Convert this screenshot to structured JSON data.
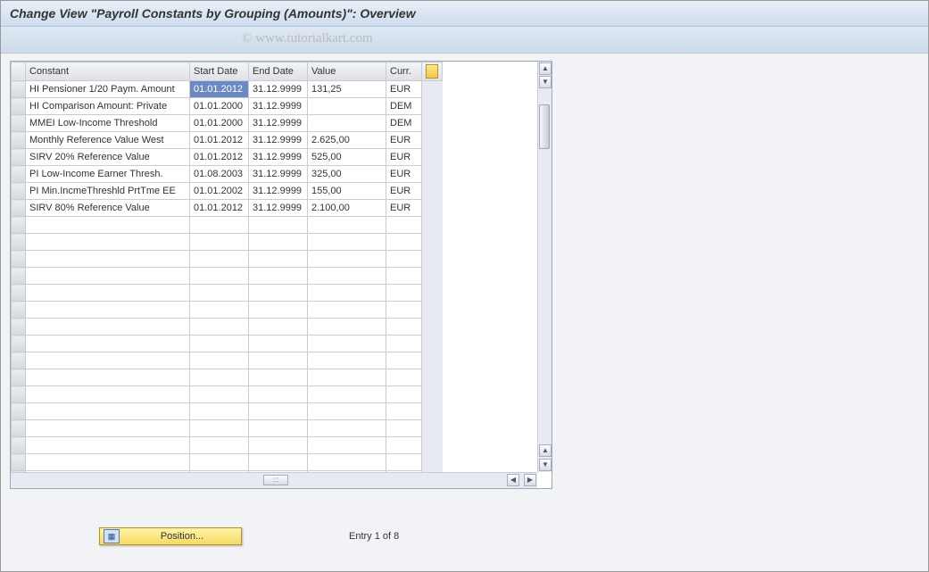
{
  "title": "Change View \"Payroll Constants by Grouping (Amounts)\": Overview",
  "watermark": "© www.tutorialkart.com",
  "columns": {
    "constant": "Constant",
    "start": "Start Date",
    "end": "End Date",
    "value": "Value",
    "curr": "Curr."
  },
  "rows": [
    {
      "constant": "HI Pensioner 1/20 Paym. Amount",
      "start": "01.01.2012",
      "end": "31.12.9999",
      "value": "131,25",
      "curr": "EUR",
      "sel": true
    },
    {
      "constant": "HI Comparison Amount: Private",
      "start": "01.01.2000",
      "end": "31.12.9999",
      "value": "",
      "curr": "DEM"
    },
    {
      "constant": "MMEI Low-Income Threshold",
      "start": "01.01.2000",
      "end": "31.12.9999",
      "value": "",
      "curr": "DEM"
    },
    {
      "constant": "Monthly Reference Value West",
      "start": "01.01.2012",
      "end": "31.12.9999",
      "value": "2.625,00",
      "curr": "EUR"
    },
    {
      "constant": "SIRV 20% Reference Value",
      "start": "01.01.2012",
      "end": "31.12.9999",
      "value": "525,00",
      "curr": "EUR"
    },
    {
      "constant": "PI Low-Income Earner Thresh.",
      "start": "01.08.2003",
      "end": "31.12.9999",
      "value": "325,00",
      "curr": "EUR"
    },
    {
      "constant": "PI Min.IncmeThreshld PrtTme EE",
      "start": "01.01.2002",
      "end": "31.12.9999",
      "value": "155,00",
      "curr": "EUR"
    },
    {
      "constant": "SIRV 80% Reference Value",
      "start": "01.01.2012",
      "end": "31.12.9999",
      "value": "2.100,00",
      "curr": "EUR"
    }
  ],
  "empty_rows": 16,
  "footer": {
    "position_label": "Position...",
    "entry_text": "Entry 1 of 8"
  }
}
